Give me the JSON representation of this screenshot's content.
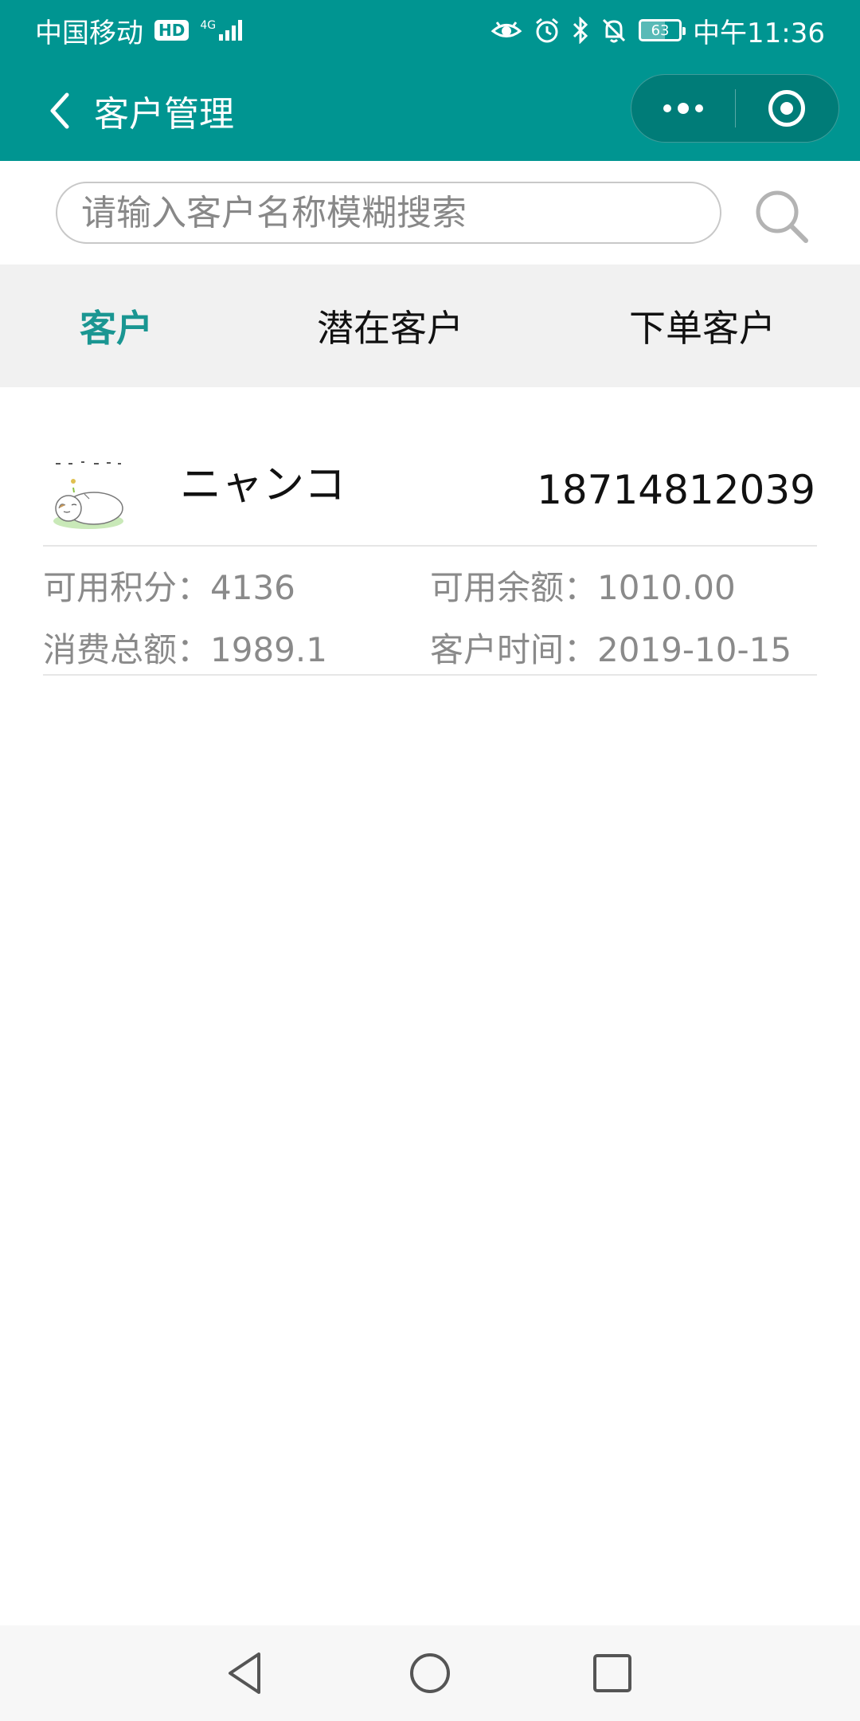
{
  "status_bar": {
    "carrier": "中国移动",
    "hd": "HD",
    "network": "4G",
    "battery": "63",
    "battery_fraction": 0.63,
    "time": "中午11:36"
  },
  "nav": {
    "title": "客户管理"
  },
  "search": {
    "placeholder": "请输入客户名称模糊搜索",
    "value": ""
  },
  "tabs": [
    {
      "label": "客户",
      "active": true
    },
    {
      "label": "潜在客户",
      "active": false
    },
    {
      "label": "下单客户",
      "active": false
    }
  ],
  "customers": [
    {
      "name": "ニャンコ",
      "phone": "18714812039",
      "points_label": "可用积分：",
      "points": "4136",
      "balance_label": "可用余额：",
      "balance": "1010.00",
      "spent_label": "消费总额：",
      "spent": "1989.1",
      "time_label": "客户时间：",
      "date": "2019-10-15"
    }
  ],
  "colors": {
    "primary": "#009591",
    "tab_active": "#1a9692",
    "tab_bg": "#f1f1f1",
    "muted_text": "#8a8a8a"
  }
}
